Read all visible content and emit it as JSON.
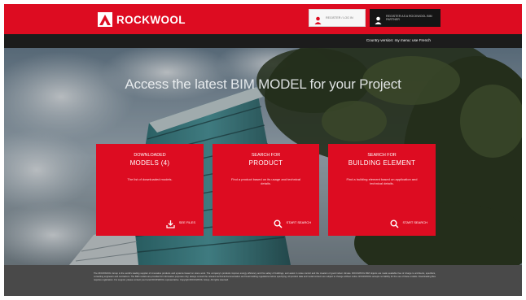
{
  "header": {
    "brand": "ROCKWOOL",
    "user_button_light": "REGISTER / LOG IN",
    "user_button_dark": "REGISTER AS A ROCKWOOL BIM PARTNER",
    "accent": "#dd0c21"
  },
  "subbar": {
    "link": "Country version: my menu: use French"
  },
  "hero": {
    "title": "Access the latest BIM MODEL for your Project"
  },
  "cards": [
    {
      "kicker": "DOWNLOADED",
      "title": "MODELS (4)",
      "description": "The list of downloaded models.",
      "action": "SEE FILES",
      "icon": "download-icon"
    },
    {
      "kicker": "SEARCH FOR",
      "title": "PRODUCT",
      "description": "Find a product based on its usage and technical details.",
      "action": "START SEARCH",
      "icon": "search-icon"
    },
    {
      "kicker": "SEARCH FOR",
      "title": "BUILDING ELEMENT",
      "description": "Find a building element based on application and technical details.",
      "action": "START SEARCH",
      "icon": "search-icon"
    }
  ],
  "footer": {
    "text": "The ROCKWOOL Group is the world's leading supplier of innovative products and systems based on stone wool. The company's products improve energy efficiency and fire safety of buildings, and assist in noise control and the creation of good indoor climate. ROCKWOOL BIM objects are made available free of charge to architects, specifiers, consulting engineers and contractors. The BIM models are provided for information purposes only; always consult the relevant technical documentation and local building regulations before specifying. All product data and model content are subject to change without notice. ROCKWOOL accepts no liability for the use of these models. Downloading files requires registration. For support, please contact your local ROCKWOOL representative. Copyright ROCKWOOL Group. All rights reserved."
  }
}
